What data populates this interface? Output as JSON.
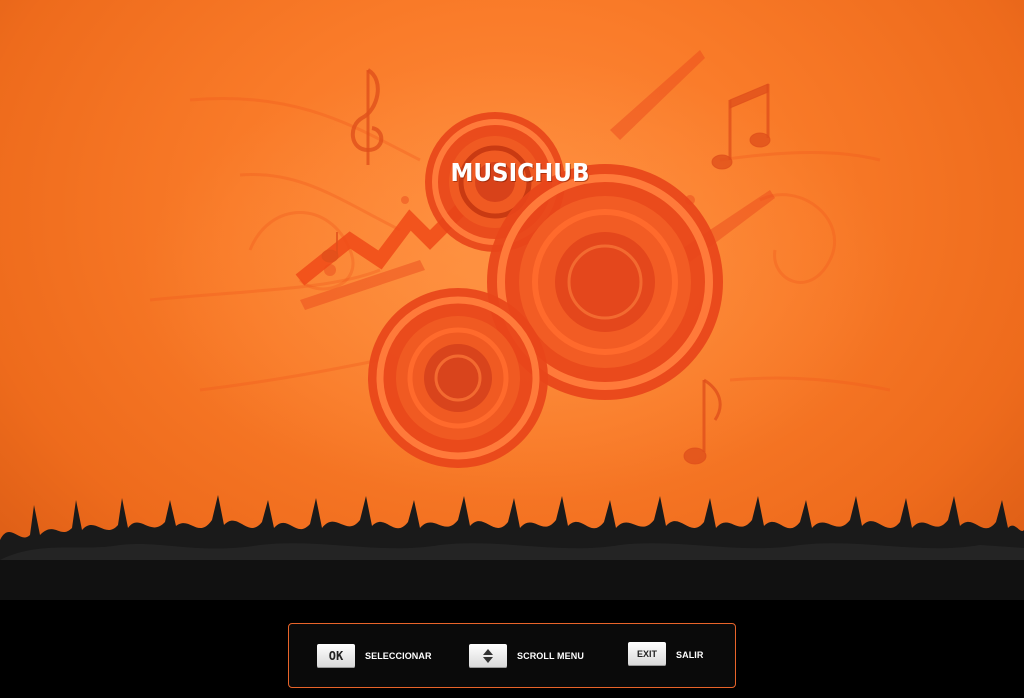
{
  "app": {
    "title": "MUSICHUB"
  },
  "hints": {
    "ok_key": "OK",
    "ok_label": "SELECCIONAR",
    "scroll_label": "SCROLL MENU",
    "exit_key": "EXIT",
    "exit_label": "SALIR"
  },
  "icons": {
    "scroll_key": "up-down-arrows-icon",
    "background_art": "speakers-music-notes-illustration",
    "crowd": "crowd-silhouette"
  },
  "colors": {
    "background_orange": "#f97a28",
    "speaker_red": "#e8451a",
    "hint_border": "#e8642a",
    "footer": "#000000"
  }
}
